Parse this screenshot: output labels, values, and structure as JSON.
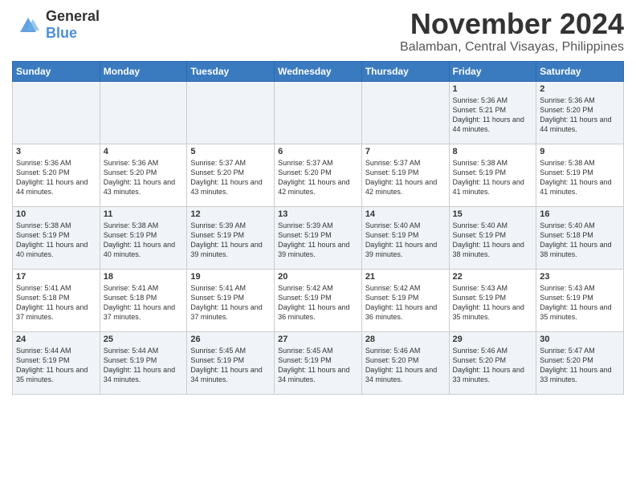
{
  "logo": {
    "general": "General",
    "blue": "Blue"
  },
  "title": "November 2024",
  "location": "Balamban, Central Visayas, Philippines",
  "days_of_week": [
    "Sunday",
    "Monday",
    "Tuesday",
    "Wednesday",
    "Thursday",
    "Friday",
    "Saturday"
  ],
  "weeks": [
    {
      "days": [
        {
          "number": "",
          "info": ""
        },
        {
          "number": "",
          "info": ""
        },
        {
          "number": "",
          "info": ""
        },
        {
          "number": "",
          "info": ""
        },
        {
          "number": "",
          "info": ""
        },
        {
          "number": "1",
          "info": "Sunrise: 5:36 AM\nSunset: 5:21 PM\nDaylight: 11 hours and 44 minutes."
        },
        {
          "number": "2",
          "info": "Sunrise: 5:36 AM\nSunset: 5:20 PM\nDaylight: 11 hours and 44 minutes."
        }
      ]
    },
    {
      "days": [
        {
          "number": "3",
          "info": "Sunrise: 5:36 AM\nSunset: 5:20 PM\nDaylight: 11 hours and 44 minutes."
        },
        {
          "number": "4",
          "info": "Sunrise: 5:36 AM\nSunset: 5:20 PM\nDaylight: 11 hours and 43 minutes."
        },
        {
          "number": "5",
          "info": "Sunrise: 5:37 AM\nSunset: 5:20 PM\nDaylight: 11 hours and 43 minutes."
        },
        {
          "number": "6",
          "info": "Sunrise: 5:37 AM\nSunset: 5:20 PM\nDaylight: 11 hours and 42 minutes."
        },
        {
          "number": "7",
          "info": "Sunrise: 5:37 AM\nSunset: 5:19 PM\nDaylight: 11 hours and 42 minutes."
        },
        {
          "number": "8",
          "info": "Sunrise: 5:38 AM\nSunset: 5:19 PM\nDaylight: 11 hours and 41 minutes."
        },
        {
          "number": "9",
          "info": "Sunrise: 5:38 AM\nSunset: 5:19 PM\nDaylight: 11 hours and 41 minutes."
        }
      ]
    },
    {
      "days": [
        {
          "number": "10",
          "info": "Sunrise: 5:38 AM\nSunset: 5:19 PM\nDaylight: 11 hours and 40 minutes."
        },
        {
          "number": "11",
          "info": "Sunrise: 5:38 AM\nSunset: 5:19 PM\nDaylight: 11 hours and 40 minutes."
        },
        {
          "number": "12",
          "info": "Sunrise: 5:39 AM\nSunset: 5:19 PM\nDaylight: 11 hours and 39 minutes."
        },
        {
          "number": "13",
          "info": "Sunrise: 5:39 AM\nSunset: 5:19 PM\nDaylight: 11 hours and 39 minutes."
        },
        {
          "number": "14",
          "info": "Sunrise: 5:40 AM\nSunset: 5:19 PM\nDaylight: 11 hours and 39 minutes."
        },
        {
          "number": "15",
          "info": "Sunrise: 5:40 AM\nSunset: 5:19 PM\nDaylight: 11 hours and 38 minutes."
        },
        {
          "number": "16",
          "info": "Sunrise: 5:40 AM\nSunset: 5:18 PM\nDaylight: 11 hours and 38 minutes."
        }
      ]
    },
    {
      "days": [
        {
          "number": "17",
          "info": "Sunrise: 5:41 AM\nSunset: 5:18 PM\nDaylight: 11 hours and 37 minutes."
        },
        {
          "number": "18",
          "info": "Sunrise: 5:41 AM\nSunset: 5:18 PM\nDaylight: 11 hours and 37 minutes."
        },
        {
          "number": "19",
          "info": "Sunrise: 5:41 AM\nSunset: 5:19 PM\nDaylight: 11 hours and 37 minutes."
        },
        {
          "number": "20",
          "info": "Sunrise: 5:42 AM\nSunset: 5:19 PM\nDaylight: 11 hours and 36 minutes."
        },
        {
          "number": "21",
          "info": "Sunrise: 5:42 AM\nSunset: 5:19 PM\nDaylight: 11 hours and 36 minutes."
        },
        {
          "number": "22",
          "info": "Sunrise: 5:43 AM\nSunset: 5:19 PM\nDaylight: 11 hours and 35 minutes."
        },
        {
          "number": "23",
          "info": "Sunrise: 5:43 AM\nSunset: 5:19 PM\nDaylight: 11 hours and 35 minutes."
        }
      ]
    },
    {
      "days": [
        {
          "number": "24",
          "info": "Sunrise: 5:44 AM\nSunset: 5:19 PM\nDaylight: 11 hours and 35 minutes."
        },
        {
          "number": "25",
          "info": "Sunrise: 5:44 AM\nSunset: 5:19 PM\nDaylight: 11 hours and 34 minutes."
        },
        {
          "number": "26",
          "info": "Sunrise: 5:45 AM\nSunset: 5:19 PM\nDaylight: 11 hours and 34 minutes."
        },
        {
          "number": "27",
          "info": "Sunrise: 5:45 AM\nSunset: 5:19 PM\nDaylight: 11 hours and 34 minutes."
        },
        {
          "number": "28",
          "info": "Sunrise: 5:46 AM\nSunset: 5:20 PM\nDaylight: 11 hours and 34 minutes."
        },
        {
          "number": "29",
          "info": "Sunrise: 5:46 AM\nSunset: 5:20 PM\nDaylight: 11 hours and 33 minutes."
        },
        {
          "number": "30",
          "info": "Sunrise: 5:47 AM\nSunset: 5:20 PM\nDaylight: 11 hours and 33 minutes."
        }
      ]
    }
  ]
}
